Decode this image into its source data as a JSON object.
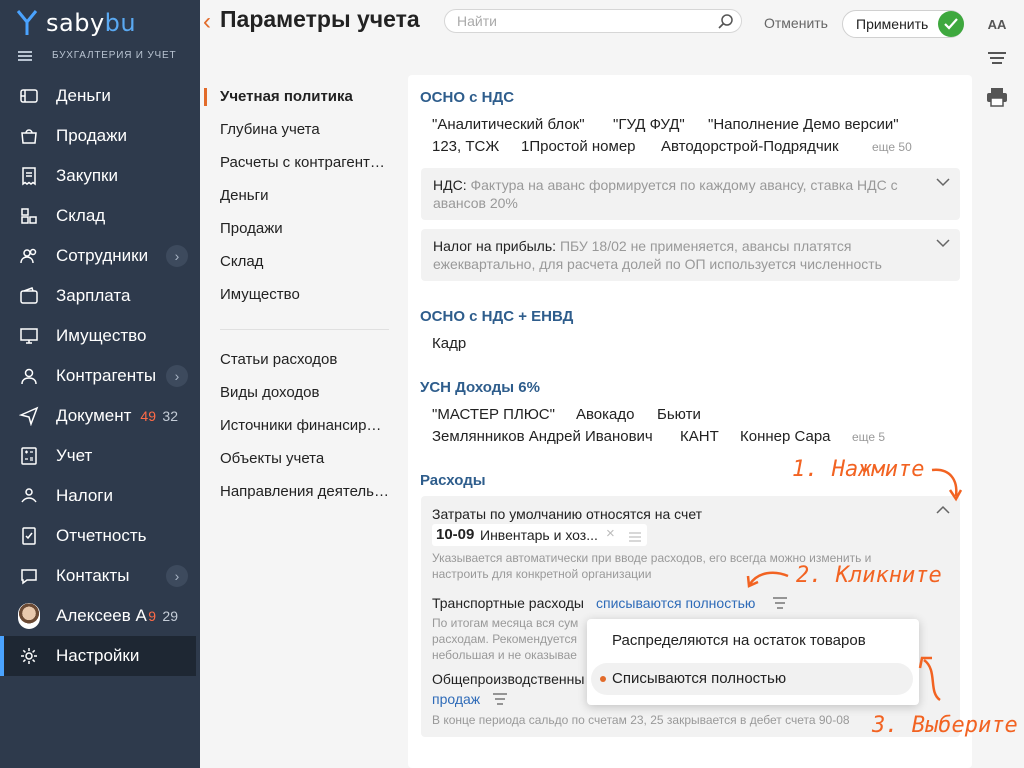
{
  "app": {
    "logo_text_a": "saby",
    "logo_text_b": "bu",
    "section_label": "БУХГАЛТЕРИЯ И УЧЕТ"
  },
  "sidebar": {
    "items": [
      {
        "label": "Деньги"
      },
      {
        "label": "Продажи"
      },
      {
        "label": "Закупки"
      },
      {
        "label": "Склад"
      },
      {
        "label": "Сотрудники"
      },
      {
        "label": "Зарплата"
      },
      {
        "label": "Имущество"
      },
      {
        "label": "Контрагенты"
      },
      {
        "label": "Документ",
        "count_red": "49",
        "count_grey": "32"
      },
      {
        "label": "Учет"
      },
      {
        "label": "Налоги"
      },
      {
        "label": "Отчетность"
      },
      {
        "label": "Контакты"
      },
      {
        "label": "Алексеев А",
        "count_red": "9",
        "count_grey": "29"
      },
      {
        "label": "Настройки"
      }
    ],
    "chevron": "›"
  },
  "header": {
    "back": "‹",
    "title": "Параметры учета",
    "search_placeholder": "Найти",
    "cancel": "Отменить",
    "apply": "Применить"
  },
  "tools": {
    "font_size": "AA"
  },
  "menu": {
    "items": [
      "Учетная политика",
      "Глубина учета",
      "Расчеты с контрагент…",
      "Деньги",
      "Продажи",
      "Склад",
      "Имущество"
    ],
    "items2": [
      "Статьи расходов",
      "Виды доходов",
      "Источники финансир…",
      "Объекты учета",
      "Направления деятель…"
    ]
  },
  "sections": {
    "osno": {
      "title": "ОСНО с НДС",
      "orgs": [
        "\"Аналитический блок\"",
        "\"ГУД ФУД\"",
        "\"Наполнение Демо версии\"",
        "123, ТСЖ",
        "1Простой номер",
        "Автодорстрой-Подрядчик"
      ],
      "more": "еще 50",
      "vat_label": "НДС:",
      "vat_text": "Фактура на аванс формируется по каждому авансу, ставка НДС с авансов 20%",
      "profit_label": "Налог на прибыль:",
      "profit_text": "ПБУ 18/02 не применяется, авансы платятся ежеквартально, для расчета долей по ОП используется численность"
    },
    "envd": {
      "title": "ОСНО с НДС + ЕНВД",
      "orgs": [
        "Кадр"
      ]
    },
    "usn": {
      "title": "УСН Доходы 6%",
      "orgs": [
        "\"МАСТЕР ПЛЮС\"",
        "Авокадо",
        "Бьюти",
        "Землянников Андрей Иванович",
        "КАНТ",
        "Коннер Сара"
      ],
      "more": "еще 5"
    },
    "expenses": {
      "title": "Расходы",
      "default_label": "Затраты по умолчанию относятся на счет",
      "account_code": "10-09",
      "account_name": "Инвентарь и хоз...",
      "default_note_1": "Указывается автоматически при вводе расходов, его всегда можно изменить и",
      "default_note_2": "настроить для конкретной организации",
      "transport_label": "Транспортные расходы",
      "transport_value": "списываются полностью",
      "transport_note_1": "По итогам месяца вся сум",
      "transport_note_2": "расходам. Рекомендуется",
      "transport_note_3": "небольшая и не оказывае",
      "overhead_label": "Общепроизводственны",
      "overhead_value": "продаж",
      "period_note": "В конце периода сальдо по счетам 23, 25 закрывается в дебет счета 90-08"
    }
  },
  "dropdown": {
    "options": [
      "Распределяются на остаток товаров",
      "Списываются полностью"
    ],
    "selected_index": 1
  },
  "hints": {
    "step1": "1. Нажмите",
    "step2": "2. Кликните",
    "step3": "3. Выберите"
  },
  "colors": {
    "sidebar": "#2e3a4c",
    "accent": "#e26b2a",
    "link": "#2e6bb8",
    "section_title": "#2e5d8c",
    "hint": "#f26322",
    "apply_check": "#3ea83e"
  }
}
